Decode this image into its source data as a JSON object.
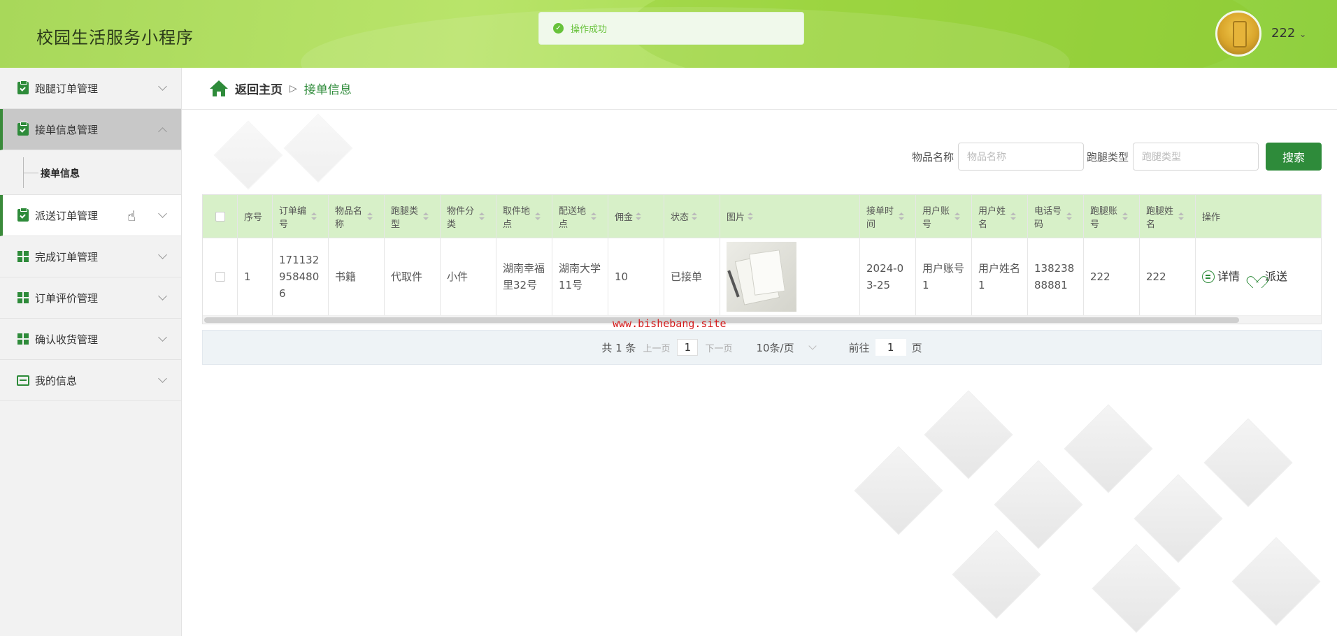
{
  "app": {
    "title": "校园生活服务小程序",
    "user_name": "222"
  },
  "toast": {
    "message": "操作成功"
  },
  "sidebar": {
    "items": [
      {
        "label": "跑腿订单管理",
        "icon": "clipboard-check-icon"
      },
      {
        "label": "接单信息管理",
        "icon": "clipboard-icon",
        "expanded": true,
        "children": [
          "接单信息"
        ]
      },
      {
        "label": "派送订单管理",
        "icon": "clipboard-check-icon"
      },
      {
        "label": "完成订单管理",
        "icon": "grid-icon"
      },
      {
        "label": "订单评价管理",
        "icon": "grid-icon"
      },
      {
        "label": "确认收货管理",
        "icon": "grid-icon"
      },
      {
        "label": "我的信息",
        "icon": "wallet-icon"
      }
    ]
  },
  "breadcrumb": {
    "home": "返回主页",
    "separator": "▷",
    "current": "接单信息"
  },
  "search": {
    "item_name_label": "物品名称",
    "item_name_placeholder": "物品名称",
    "errand_type_label": "跑腿类型",
    "errand_type_placeholder": "跑腿类型",
    "button": "搜索"
  },
  "table": {
    "columns": [
      "序号",
      "订单编号",
      "物品名称",
      "跑腿类型",
      "物件分类",
      "取件地点",
      "配送地点",
      "佣金",
      "状态",
      "图片",
      "接单时间",
      "用户账号",
      "用户姓名",
      "电话号码",
      "跑腿账号",
      "跑腿姓名",
      "操作"
    ],
    "rows": [
      {
        "index": "1",
        "order_no": "1711329584806",
        "item_name": "书籍",
        "errand_type": "代取件",
        "category": "小件",
        "pickup": "湖南幸福里32号",
        "delivery": "湖南大学11号",
        "commission": "10",
        "status": "已接单",
        "accept_time": "2024-03-25",
        "user_account": "用户账号1",
        "user_name": "用户姓名1",
        "phone": "13823888881",
        "runner_account": "222",
        "runner_name": "222",
        "actions": {
          "detail": "详情",
          "dispatch": "派送"
        }
      }
    ]
  },
  "watermark": "www.bishebang.site",
  "pagination": {
    "total_text": "共 1 条",
    "prev": "上一页",
    "current_page": "1",
    "next": "下一页",
    "page_size": "10条/页",
    "goto_prefix": "前往",
    "goto_value": "1",
    "goto_suffix": "页"
  },
  "colors": {
    "accent": "#2e8b3a",
    "header": "#a8d85a",
    "table_header": "#d7f0c8",
    "success": "#67c23a"
  }
}
